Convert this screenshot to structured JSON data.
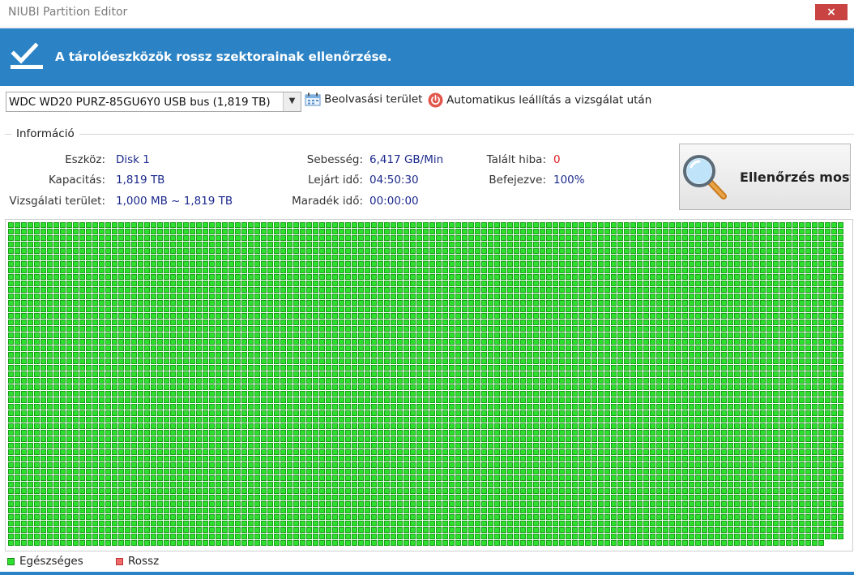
{
  "window": {
    "title": "NIUBI Partition Editor",
    "close_glyph": "×"
  },
  "header": {
    "text": "A tárolóeszközök rossz szektorainak ellenőrzése.",
    "icon": "check-icon",
    "bg_color": "#2b83c5"
  },
  "toolbar": {
    "disk_select_value": "WDC WD20 PURZ-85GU6Y0 USB bus (1,819 TB)",
    "scan_area_label": "Beolvasási terület",
    "scan_area_icon": "calendar-icon",
    "shutdown_label": "Automatikus leállítás a vizsgálat után",
    "shutdown_icon": "power-icon"
  },
  "info": {
    "legend": "Információ",
    "device_label": "Eszköz:",
    "device_value": "Disk 1",
    "capacity_label": "Kapacitás:",
    "capacity_value": "1,819 TB",
    "scan_area_label": "Vizsgálati terület:",
    "scan_area_value": "1,000 MB ~ 1,819 TB",
    "speed_label": "Sebesség:",
    "speed_value": "6,417 GB/Min",
    "elapsed_label": "Lejárt idő:",
    "elapsed_value": "04:50:30",
    "remaining_label": "Maradék idő:",
    "remaining_value": "00:00:00",
    "errors_label": "Talált hiba:",
    "errors_value": "0",
    "done_label": "Befejezve:",
    "done_value": "100%"
  },
  "check_button": {
    "label": "Ellenőrzés most",
    "icon": "magnifier-icon"
  },
  "block_map": {
    "healthy_color": "#2ee02e",
    "healthy_border": "#1a9e1a",
    "bad_color": "#f26b6b",
    "progress": 1.0,
    "last_row_fill_fraction": 0.98
  },
  "legend": {
    "healthy_label": "Egészséges",
    "bad_label": "Rossz",
    "healthy_color": "#2ee02e",
    "bad_color": "#f26b6b"
  }
}
